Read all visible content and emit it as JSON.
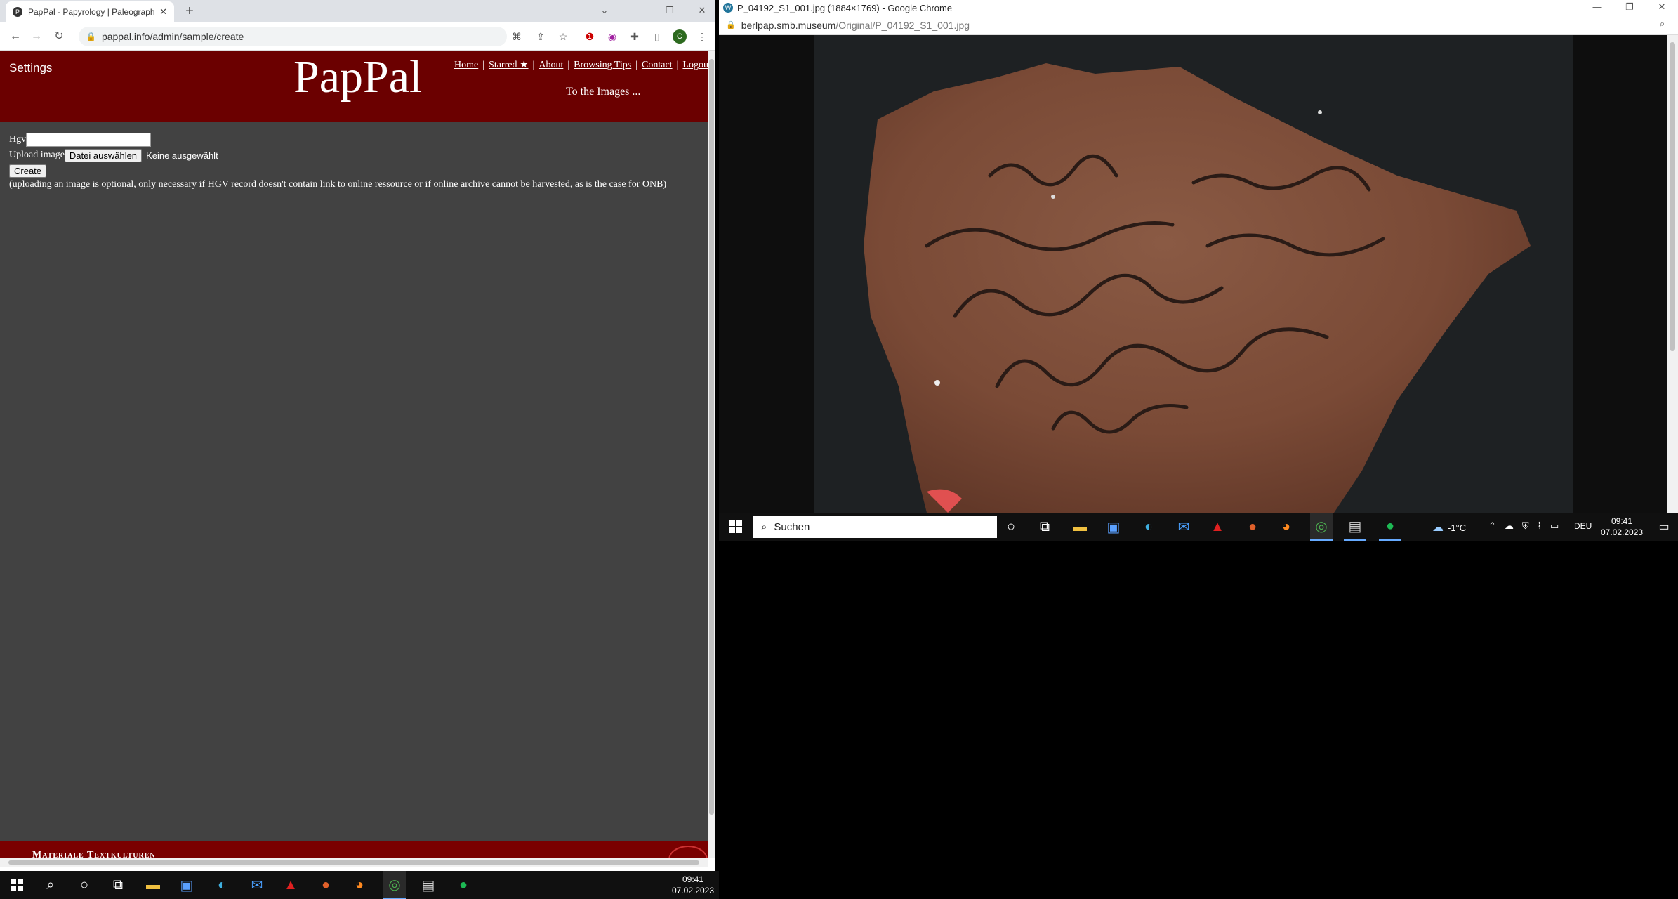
{
  "left_window": {
    "tab_title": "PapPal - Papyrology | Paleograph",
    "url": "pappal.info/admin/sample/create",
    "profile_initial": "C",
    "page": {
      "settings": "Settings",
      "logo": "PapPal",
      "nav": [
        "Home",
        "Starred ★",
        "About",
        "Browsing Tips",
        "Contact",
        "Logou"
      ],
      "to_images": "To the Images ...",
      "form": {
        "hgv_label": "Hgv",
        "upload_label": "Upload image",
        "file_button": "Datei auswählen",
        "file_status": "Keine ausgewählt",
        "create_button": "Create",
        "note": "(uploading an image is optional, only necessary if HGV record doesn't contain link to online ressource or if online archive cannot be harvested, as is the case for ONB)"
      },
      "footer": "Materiale Textkulturen"
    }
  },
  "right_window": {
    "title": "P_04192_S1_001.jpg (1884×1769) - Google Chrome",
    "url_host": "berlpap.smb.museum",
    "url_path": "/Original/P_04192_S1_001.jpg"
  },
  "taskbar_right": {
    "search_placeholder": "Suchen",
    "weather": "-1°C",
    "lang": "DEU",
    "time": "09:41",
    "date": "07.02.2023"
  },
  "taskbar_left": {
    "time": "09:41",
    "date": "07.02.2023"
  },
  "colors": {
    "header_red": "#6b0000",
    "page_bg": "#424242"
  }
}
